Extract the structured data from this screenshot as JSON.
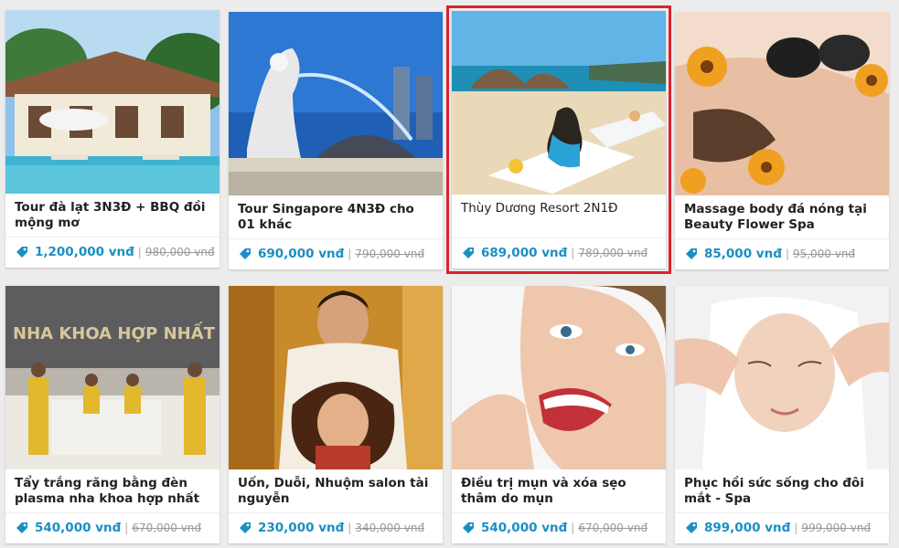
{
  "deals": [
    {
      "title": "Tour đà lạt 3N3Đ + BBQ đồi mộng mơ",
      "price": "1,200,000 vnđ",
      "old_price": "980,000 vnđ",
      "image": "resort-pool-photo",
      "selected": false
    },
    {
      "title": "Tour Singapore 4N3Đ cho 01 khác",
      "price": "690,000 vnđ",
      "old_price": "790,000 vnđ",
      "image": "merlion-singapore-photo",
      "selected": false
    },
    {
      "title": "Thùy Dương Resort 2N1Đ",
      "price": "689,000 vnđ",
      "old_price": "789,000 vnđ",
      "image": "beach-resort-photo",
      "selected": true
    },
    {
      "title": "Massage body đá nóng tại Beauty Flower Spa",
      "price": "85,000 vnđ",
      "old_price": "95,000 vnđ",
      "image": "hot-stone-massage-photo",
      "selected": false
    },
    {
      "title": "Tẩy trắng răng bằng đèn plasma nha khoa hợp nhất",
      "price": "540,000 vnđ",
      "old_price": "670,000 vnđ",
      "image": "dental-clinic-photo",
      "selected": false,
      "photo_sign": "NHA KHOA HỢP NHẤT"
    },
    {
      "title": "Uốn, Duỗi, Nhuộm salon tài nguyễn",
      "price": "230,000 vnđ",
      "old_price": "340,000 vnđ",
      "image": "hair-salon-photo",
      "selected": false
    },
    {
      "title": "Điều trị mụn và xóa sẹo thâm do mụn",
      "price": "540,000 vnđ",
      "old_price": "670,000 vnđ",
      "image": "smiling-woman-teeth-photo",
      "selected": false
    },
    {
      "title": "Phục hồi sức sống cho đôi mắt - Spa",
      "price": "899,000 vnđ",
      "old_price": "999,000 vnđ",
      "image": "facial-spa-photo",
      "selected": false
    }
  ],
  "colors": {
    "accent": "#1a8fc4",
    "selection": "#d9232d",
    "old_price": "#999999"
  },
  "icons": {
    "price_tag": "price-tag-icon"
  }
}
